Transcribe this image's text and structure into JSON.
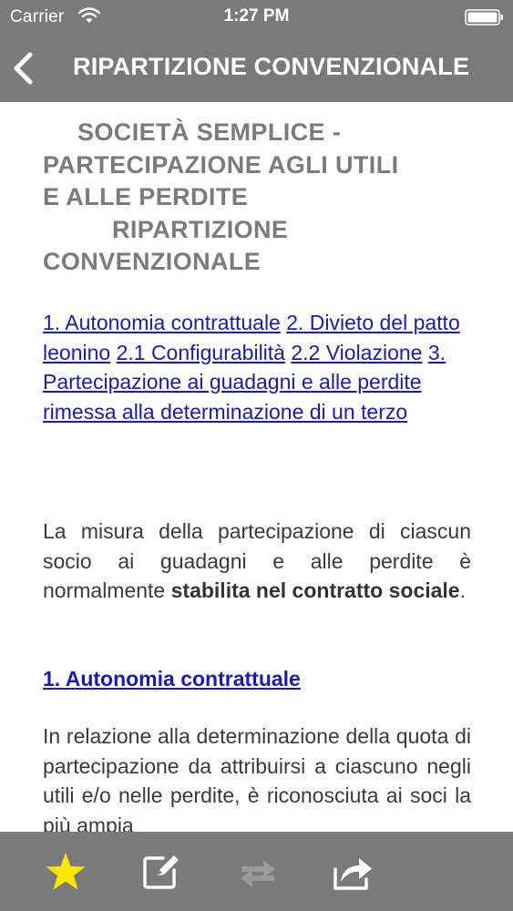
{
  "status_bar": {
    "carrier": "Carrier",
    "time": "1:27 PM"
  },
  "nav": {
    "title": "RIPARTIZIONE CONVENZIONALE",
    "back_icon": "chevron-left-icon"
  },
  "document": {
    "title_lines": [
      "SOCIETÀ SEMPLICE -",
      "PARTECIPAZIONE AGLI UTILI",
      "E ALLE PERDITE",
      "RIPARTIZIONE",
      "CONVENZIONALE"
    ],
    "toc": [
      "1. Autonomia contrattuale",
      "2. Divieto del patto leonino",
      "2.1 Configurabilità",
      "2.2 Violazione",
      "3. Partecipazione ai guadagni e alle perdite rimessa alla determinazione di un terzo"
    ],
    "paragraph1": {
      "text": "La misura della partecipazione di ciascun socio ai guadagni e alle perdite è normalmente",
      "bold": "stabilita nel contratto sociale",
      "end": "."
    },
    "section1_heading": "1. Autonomia contrattuale",
    "paragraph2": "In relazione alla determinazione della quota di partecipazione da attribuirsi a ciascuno negli utili e/o nelle perdite, è riconosciuta ai soci la più ampia"
  },
  "toolbar": {
    "icons": [
      "star-icon",
      "edit-icon",
      "sync-arrows-icon",
      "share-icon"
    ]
  },
  "colors": {
    "bar_background": "#7a7a7a",
    "title_gray": "#7b7b7b",
    "link_blue": "#1a1ab8",
    "star_yellow": "#ffe600",
    "disabled_icon": "#9a9a9a"
  }
}
